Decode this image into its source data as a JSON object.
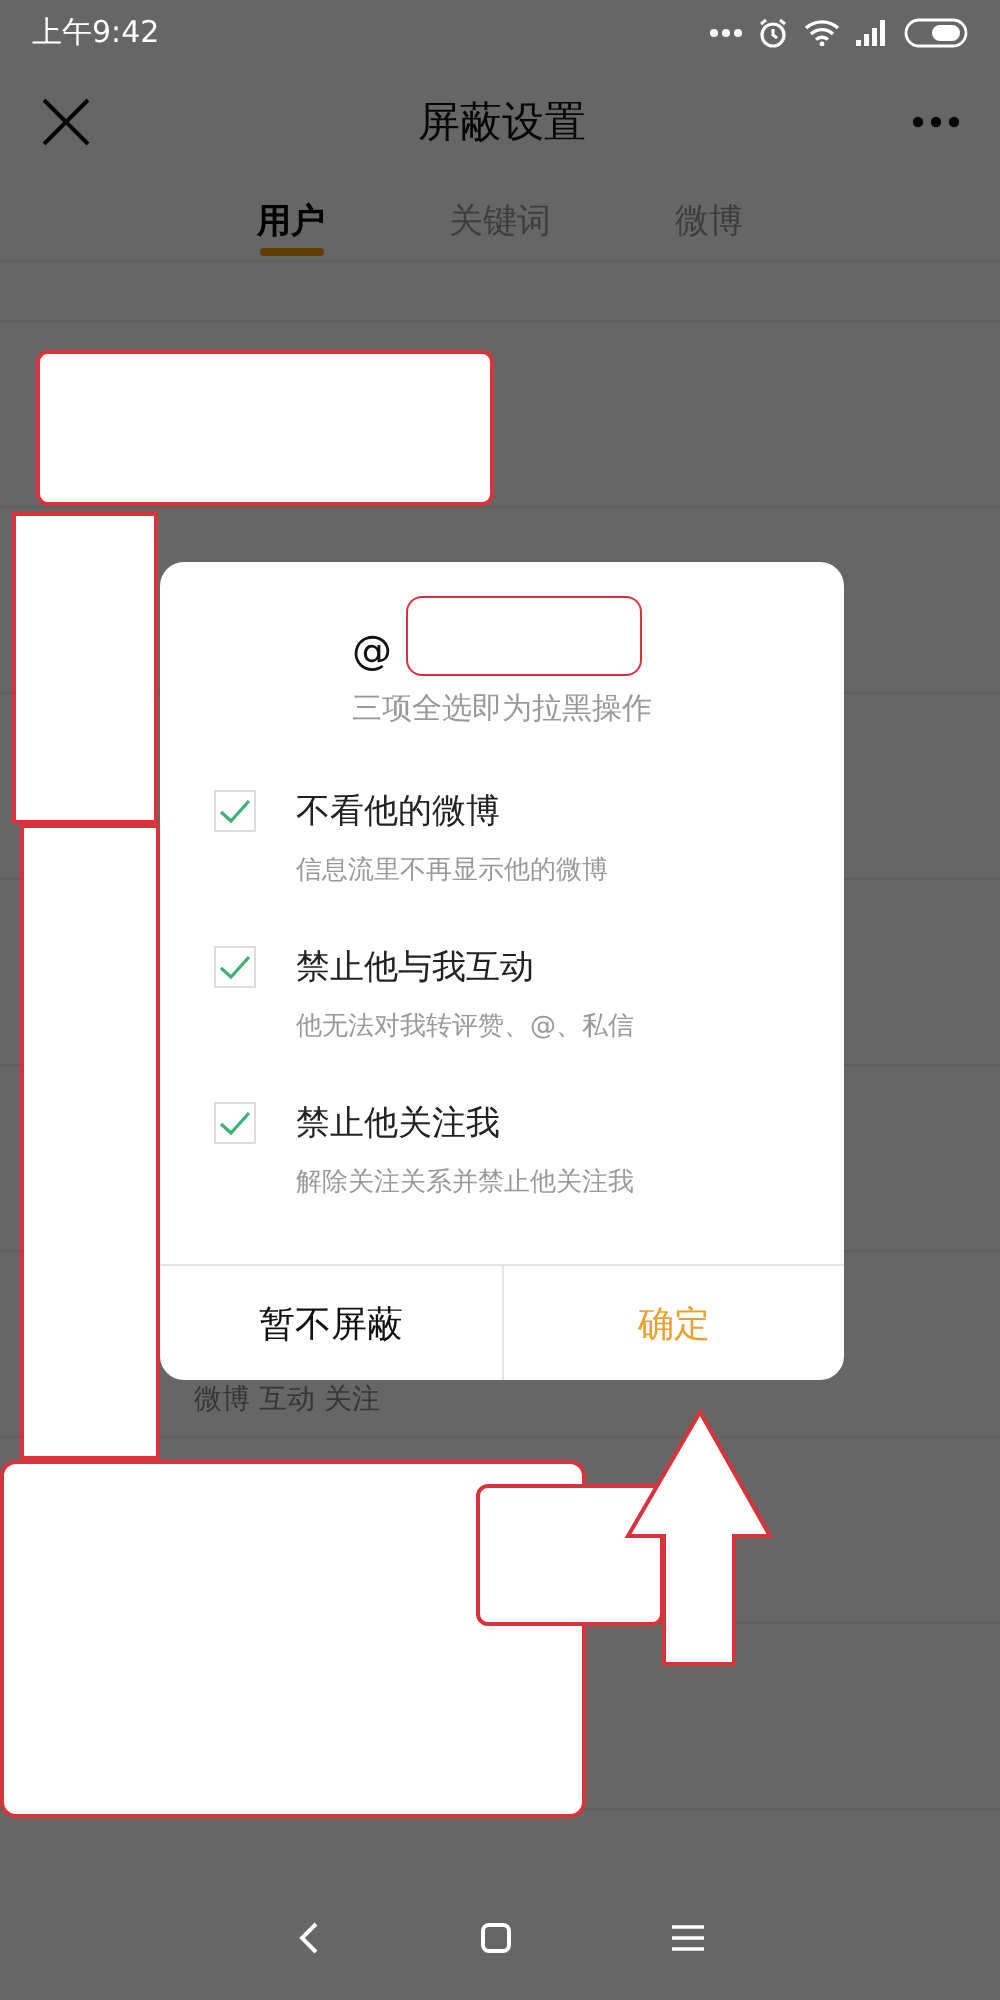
{
  "status_bar": {
    "time": "上午9:42"
  },
  "header": {
    "title": "屏蔽设置"
  },
  "tabs": [
    {
      "label": "用户",
      "selected": true
    },
    {
      "label": "关键词",
      "selected": false
    },
    {
      "label": "微博",
      "selected": false
    }
  ],
  "background_list": {
    "subtitle": "微博 互动 关注"
  },
  "dialog": {
    "title": "@",
    "subtitle": "三项全选即为拉黑操作",
    "options": [
      {
        "label": "不看他的微博",
        "description": "信息流里不再显示他的微博",
        "checked": true
      },
      {
        "label": "禁止他与我互动",
        "description": "他无法对我转评赞、@、私信",
        "checked": true
      },
      {
        "label": "禁止他关注我",
        "description": "解除关注关系并禁止他关注我",
        "checked": true
      }
    ],
    "buttons": [
      {
        "label": "暂不屏蔽",
        "kind": "cancel"
      },
      {
        "label": "确定",
        "kind": "confirm"
      }
    ]
  }
}
